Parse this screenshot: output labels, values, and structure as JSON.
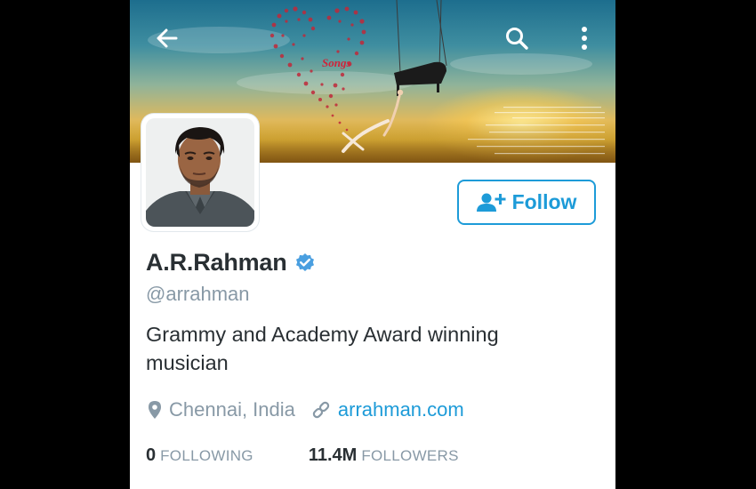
{
  "banner": {
    "songs_text": "Songs",
    "back_icon": "arrow-left-icon",
    "search_icon": "search-icon",
    "more_icon": "more-vertical-icon"
  },
  "profile": {
    "name": "A.R.Rahman",
    "verified_icon": "verified-badge-icon",
    "handle": "@arrahman",
    "bio": "Grammy and Academy Award winning musician",
    "location": "Chennai, India",
    "website": "arrahman.com"
  },
  "follow_button": {
    "label": "Follow",
    "icon": "add-user-icon"
  },
  "stats": {
    "following_count": "0",
    "following_label": "FOLLOWING",
    "followers_count": "11.4M",
    "followers_label": "FOLLOWERS"
  },
  "colors": {
    "accent": "#1d9bd8",
    "text_primary": "#292f33",
    "text_secondary": "#8899a6",
    "verified": "#4a9fe0"
  }
}
